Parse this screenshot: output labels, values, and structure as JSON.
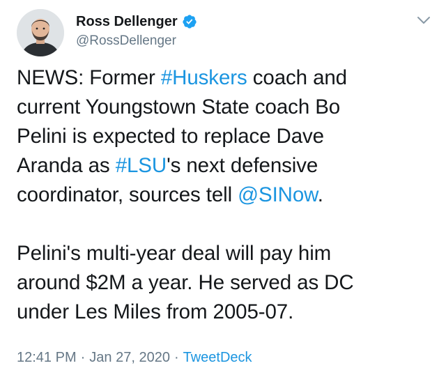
{
  "user": {
    "display_name": "Ross Dellenger",
    "handle": "@RossDellenger",
    "verified": true
  },
  "tweet": {
    "paragraph1": [
      [
        {
          "t": "NEWS: Former "
        },
        {
          "t": "#Huskers",
          "link": true
        },
        {
          "t": " coach and"
        }
      ],
      [
        {
          "t": "current Youngstown State coach Bo"
        }
      ],
      [
        {
          "t": "Pelini is expected to replace Dave"
        }
      ],
      [
        {
          "t": "Aranda as "
        },
        {
          "t": "#LSU",
          "link": true
        },
        {
          "t": "'s next defensive"
        }
      ],
      [
        {
          "t": "coordinator, sources tell "
        },
        {
          "t": "@SINow",
          "link": true
        },
        {
          "t": "."
        }
      ]
    ],
    "paragraph2": [
      [
        {
          "t": "Pelini's multi-year deal will pay him"
        }
      ],
      [
        {
          "t": "around $2M a year. He served as DC"
        }
      ],
      [
        {
          "t": "under Les Miles from 2005-07."
        }
      ]
    ]
  },
  "meta": {
    "time": "12:41 PM",
    "separator": "·",
    "date": "Jan 27, 2020",
    "source": "TweetDeck"
  },
  "colors": {
    "link": "#1b95e0",
    "secondary_text": "#657786",
    "primary_text": "#14171a",
    "verified_badge": "#1da1f2"
  },
  "icons": {
    "verified": "verified-badge-icon",
    "menu": "chevron-down-icon"
  }
}
